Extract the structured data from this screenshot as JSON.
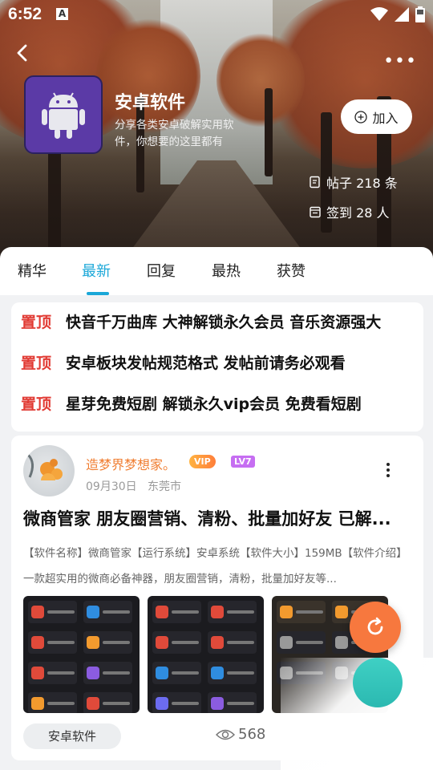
{
  "status_bar": {
    "time": "6:52",
    "notification_icon": "a-icon"
  },
  "app": {
    "name": "安卓软件",
    "description": "分享各类安卓破解实用软件，你想要的这里都有",
    "join_label": "加入",
    "stats": {
      "posts": "帖子 218 条",
      "checkins": "签到 28 人"
    }
  },
  "tabs": [
    {
      "label": "精华",
      "active": false
    },
    {
      "label": "最新",
      "active": true
    },
    {
      "label": "回复",
      "active": false
    },
    {
      "label": "最热",
      "active": false
    },
    {
      "label": "获赞",
      "active": false
    }
  ],
  "pinned": [
    {
      "tag": "置顶",
      "text": "快音千万曲库 大神解锁永久会员 音乐资源强大"
    },
    {
      "tag": "置顶",
      "text": "安卓板块发帖规范格式 发帖前请务必观看"
    },
    {
      "tag": "置顶",
      "text": "星芽免费短剧 解锁永久vip会员 免费看短剧"
    }
  ],
  "post": {
    "username": "造梦界梦想家。",
    "vip_badge": "VIP",
    "level_badge": "LV7",
    "date": "09月30日",
    "location": "东莞市",
    "title": "微商管家 朋友圈营销、清粉、批量加好友 已解...",
    "excerpt": "【软件名称】微商管家【运行系统】安卓系统【软件大小】159MB【软件介绍】一款超实用的微商必备神器，朋友圈营销，清粉，批量加好友等...",
    "category": "安卓软件",
    "views": "568"
  },
  "colors": {
    "accent": "#1aa7d8",
    "pin_red": "#e13b34",
    "username_orange": "#f07e32",
    "fab": "#f7783e"
  }
}
